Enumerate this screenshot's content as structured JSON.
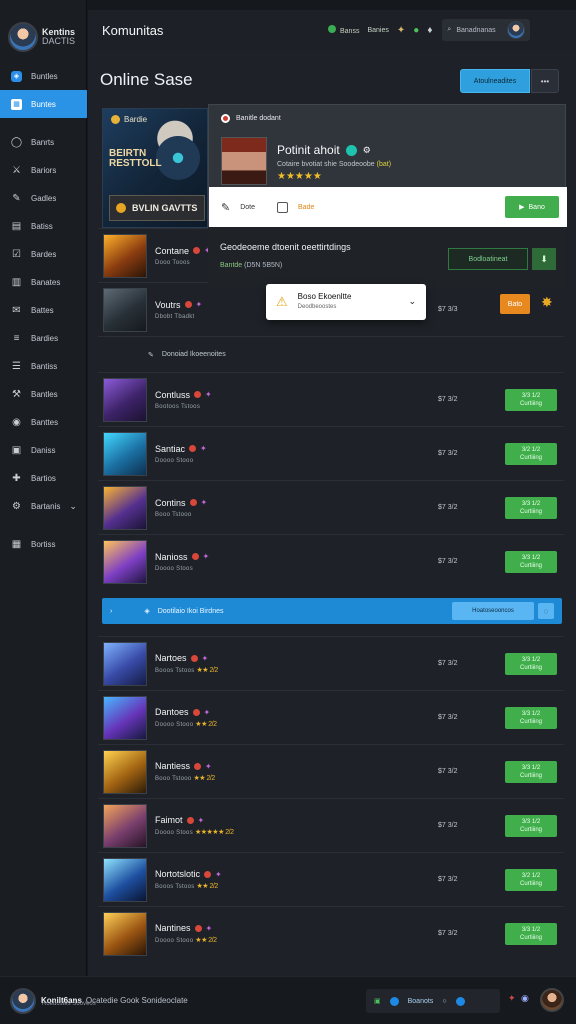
{
  "brand": {
    "line1": "Kentins",
    "line2": "DACTIS"
  },
  "sidebar": {
    "items": [
      {
        "label": "Buntles",
        "icon": "shield-icon",
        "style": "blue"
      },
      {
        "label": "Buntes",
        "icon": "grid-icon",
        "style": "active"
      },
      {
        "label": "Banrts",
        "icon": "user-icon",
        "style": ""
      },
      {
        "label": "Bariors",
        "icon": "sword-icon",
        "style": ""
      },
      {
        "label": "Gadles",
        "icon": "pen-icon",
        "style": ""
      },
      {
        "label": "Batiss",
        "icon": "calendar-icon",
        "style": ""
      },
      {
        "label": "Bardes",
        "icon": "check-box-icon",
        "style": ""
      },
      {
        "label": "Banates",
        "icon": "book-icon",
        "style": ""
      },
      {
        "label": "Battes",
        "icon": "mail-icon",
        "style": ""
      },
      {
        "label": "Bardies",
        "icon": "list-icon",
        "style": ""
      },
      {
        "label": "Bantiss",
        "icon": "sliders-icon",
        "style": ""
      },
      {
        "label": "Bantles",
        "icon": "wrench-icon",
        "style": ""
      },
      {
        "label": "Banttes",
        "icon": "globe-icon",
        "style": ""
      },
      {
        "label": "Daniss",
        "icon": "inbox-icon",
        "style": ""
      },
      {
        "label": "Bartios",
        "icon": "gamepad-icon",
        "style": ""
      },
      {
        "label": "Bartanis",
        "icon": "settings-icon",
        "style": ""
      },
      {
        "label": "Bortiss",
        "icon": "table-icon",
        "style": ""
      }
    ]
  },
  "topbar": {
    "title": "Komunitas",
    "link1": "Banss",
    "link2": "Banies",
    "search_text": "Banadnanas"
  },
  "page": {
    "title": "Online Sase",
    "primary_button": "Atoulneadites"
  },
  "hero": {
    "category": "Bardie",
    "art_title": "BEIRTN RESTTOLL",
    "button": "BVLIN GAVTTS"
  },
  "popup": {
    "header": "Banitle dodant",
    "name": "Potinit ahoit",
    "desc": "Cotaire bvotiat shie Soodeoobe",
    "desc_highlight": "(bat)",
    "stars": "★★★★★",
    "pin_label": "Dote",
    "check_label": "Bade",
    "ok_button": "Bano"
  },
  "notice": {
    "title": "Geodeoeme dtoenit oeettirtdings",
    "sub_green": "Bantde",
    "sub_text": "(D5N 5B5N)",
    "button": "Bodloatineat"
  },
  "dropdown": {
    "title": "Boso Ekoenltte",
    "subtitle": "Deodbeoostes"
  },
  "rows": [
    {
      "name": "Contane",
      "sub": "Dooo Tooos",
      "stars": "",
      "price": "",
      "buy1": "",
      "buy2": "",
      "thumb": "t1"
    },
    {
      "name": "Voutrs",
      "sub": "Dbobt Tbadkt",
      "stars": "",
      "price": "$7 3/3",
      "buy1": "",
      "buy2": "",
      "thumb": "t2"
    }
  ],
  "info_bar": "Donoiad Ikoeenoites",
  "orange_button": "Bato",
  "rows2": [
    {
      "name": "Contluss",
      "sub": "Bootoos Tstoos",
      "stars": "",
      "price": "$7 3/2",
      "buy1": "3/3 1/2",
      "buy2": "Curtiiing",
      "thumb": "t3"
    },
    {
      "name": "Santiac",
      "sub": "Doooo Stooo",
      "stars": "",
      "price": "$7 3/2",
      "buy1": "3/2 1/2",
      "buy2": "Curtiiing",
      "thumb": "t4"
    },
    {
      "name": "Contins",
      "sub": "Booo Tstooo",
      "stars": "",
      "price": "$7 3/2",
      "buy1": "3/3 1/2",
      "buy2": "Curtiiing",
      "thumb": "t5"
    },
    {
      "name": "Nanioss",
      "sub": "Doooo Stoos",
      "stars": "",
      "price": "$7 3/2",
      "buy1": "3/3 1/2",
      "buy2": "Curtiiing",
      "thumb": "t6"
    }
  ],
  "blue_bar": {
    "text": "Dootilaio Ikoi Birdnes",
    "button": "Hoatoseooncos"
  },
  "rows3": [
    {
      "name": "Nartoes",
      "sub": "Booos Tstoos",
      "stars": "★★ 2/2",
      "price": "$7 3/2",
      "buy1": "3/3 1/2",
      "buy2": "Curtiiing",
      "thumb": "t7"
    },
    {
      "name": "Dantoes",
      "sub": "Doooo Stooo",
      "stars": "★★ 2/2",
      "price": "$7 3/2",
      "buy1": "3/3 1/2",
      "buy2": "Curtiiing",
      "thumb": "t8"
    },
    {
      "name": "Nantiess",
      "sub": "Booo Tstooo",
      "stars": "★★ 2/2",
      "price": "$7 3/2",
      "buy1": "3/3 1/2",
      "buy2": "Curtiiing",
      "thumb": "t9"
    },
    {
      "name": "Faimot",
      "sub": "Doooo Stoos",
      "stars": "★★★★★ 2/2",
      "price": "$7 3/2",
      "buy1": "3/3 1/2",
      "buy2": "Curtiiing",
      "thumb": "t10"
    },
    {
      "name": "Nortotslotic",
      "sub": "Booos Tstoos",
      "stars": "★★ 2/2",
      "price": "$7 3/2",
      "buy1": "3/2 1/2",
      "buy2": "Curtiiing",
      "thumb": "t11"
    },
    {
      "name": "Nantines",
      "sub": "Doooo Stooo",
      "stars": "★★ 2/2",
      "price": "$7 3/2",
      "buy1": "3/3 1/2",
      "buy2": "Curtiiing",
      "thumb": "t12"
    }
  ],
  "bottombar": {
    "title": "Konilt6ans",
    "title_rest": "Ocatedie Gook Sonideoclate",
    "sub": "Roedostes Sooveos",
    "pill_text": "Boanots"
  }
}
